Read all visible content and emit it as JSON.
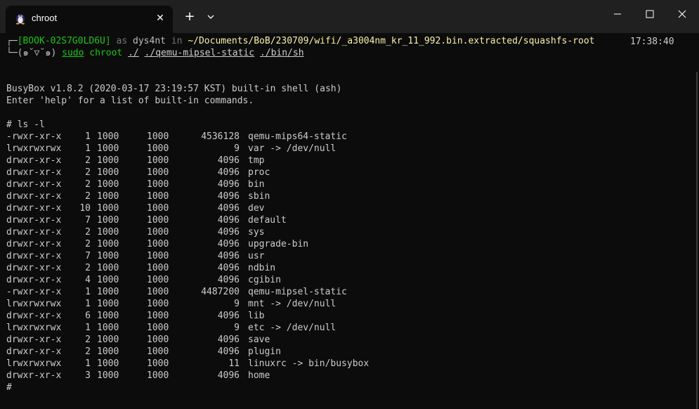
{
  "window": {
    "tab_title": "chroot",
    "tab_icon": "tux-icon",
    "close_tab_symbol": "✕",
    "new_tab_symbol": "+",
    "dropdown_icon": "chevron-down-icon",
    "controls": [
      "minimize-icon",
      "maximize-icon",
      "close-icon"
    ]
  },
  "prompt": {
    "host": "[BOOK-02S7G0LD6U]",
    "as_word": "as",
    "user": "dys4nt",
    "in_word": "in",
    "path": "~/Documents/BoB/230709/wifi/_a3004nm_kr_11_992.bin.extracted/squashfs-root",
    "time": "17:38:40",
    "face": "(๑˘▽˘๑)",
    "cmd_sudo": "sudo",
    "cmd_chroot": "chroot",
    "arg1": "./",
    "arg2": "./qemu-mipsel-static",
    "arg3": "./bin/sh"
  },
  "output": {
    "banner1": "BusyBox v1.8.2 (2020-03-17 23:19:57 KST) built-in shell (ash)",
    "banner2": "Enter 'help' for a list of built-in commands.",
    "ls_cmd": "# ls -l",
    "final_prompt": "#"
  },
  "listing": [
    {
      "perm": "-rwxr-xr-x",
      "links": "1",
      "user": "1000",
      "group": "1000",
      "size": "4536128",
      "name": "qemu-mips64-static"
    },
    {
      "perm": "lrwxrwxrwx",
      "links": "1",
      "user": "1000",
      "group": "1000",
      "size": "9",
      "name": "var -> /dev/null"
    },
    {
      "perm": "drwxr-xr-x",
      "links": "2",
      "user": "1000",
      "group": "1000",
      "size": "4096",
      "name": "tmp"
    },
    {
      "perm": "drwxr-xr-x",
      "links": "2",
      "user": "1000",
      "group": "1000",
      "size": "4096",
      "name": "proc"
    },
    {
      "perm": "drwxr-xr-x",
      "links": "2",
      "user": "1000",
      "group": "1000",
      "size": "4096",
      "name": "bin"
    },
    {
      "perm": "drwxr-xr-x",
      "links": "2",
      "user": "1000",
      "group": "1000",
      "size": "4096",
      "name": "sbin"
    },
    {
      "perm": "drwxr-xr-x",
      "links": "10",
      "user": "1000",
      "group": "1000",
      "size": "4096",
      "name": "dev"
    },
    {
      "perm": "drwxr-xr-x",
      "links": "7",
      "user": "1000",
      "group": "1000",
      "size": "4096",
      "name": "default"
    },
    {
      "perm": "drwxr-xr-x",
      "links": "2",
      "user": "1000",
      "group": "1000",
      "size": "4096",
      "name": "sys"
    },
    {
      "perm": "drwxr-xr-x",
      "links": "2",
      "user": "1000",
      "group": "1000",
      "size": "4096",
      "name": "upgrade-bin"
    },
    {
      "perm": "drwxr-xr-x",
      "links": "7",
      "user": "1000",
      "group": "1000",
      "size": "4096",
      "name": "usr"
    },
    {
      "perm": "drwxr-xr-x",
      "links": "2",
      "user": "1000",
      "group": "1000",
      "size": "4096",
      "name": "ndbin"
    },
    {
      "perm": "drwxr-xr-x",
      "links": "4",
      "user": "1000",
      "group": "1000",
      "size": "4096",
      "name": "cgibin"
    },
    {
      "perm": "-rwxr-xr-x",
      "links": "1",
      "user": "1000",
      "group": "1000",
      "size": "4487200",
      "name": "qemu-mipsel-static"
    },
    {
      "perm": "lrwxrwxrwx",
      "links": "1",
      "user": "1000",
      "group": "1000",
      "size": "9",
      "name": "mnt -> /dev/null"
    },
    {
      "perm": "drwxr-xr-x",
      "links": "6",
      "user": "1000",
      "group": "1000",
      "size": "4096",
      "name": "lib"
    },
    {
      "perm": "lrwxrwxrwx",
      "links": "1",
      "user": "1000",
      "group": "1000",
      "size": "9",
      "name": "etc -> /dev/null"
    },
    {
      "perm": "drwxr-xr-x",
      "links": "2",
      "user": "1000",
      "group": "1000",
      "size": "4096",
      "name": "save"
    },
    {
      "perm": "drwxr-xr-x",
      "links": "2",
      "user": "1000",
      "group": "1000",
      "size": "4096",
      "name": "plugin"
    },
    {
      "perm": "lrwxrwxrwx",
      "links": "1",
      "user": "1000",
      "group": "1000",
      "size": "11",
      "name": "linuxrc -> bin/busybox"
    },
    {
      "perm": "drwxr-xr-x",
      "links": "3",
      "user": "1000",
      "group": "1000",
      "size": "4096",
      "name": "home"
    }
  ],
  "colors": {
    "background": "#0c0c0c",
    "titlebar": "#202020",
    "green": "#16c60c",
    "blue": "#3b78ff",
    "yellow": "#f9f1a5"
  }
}
